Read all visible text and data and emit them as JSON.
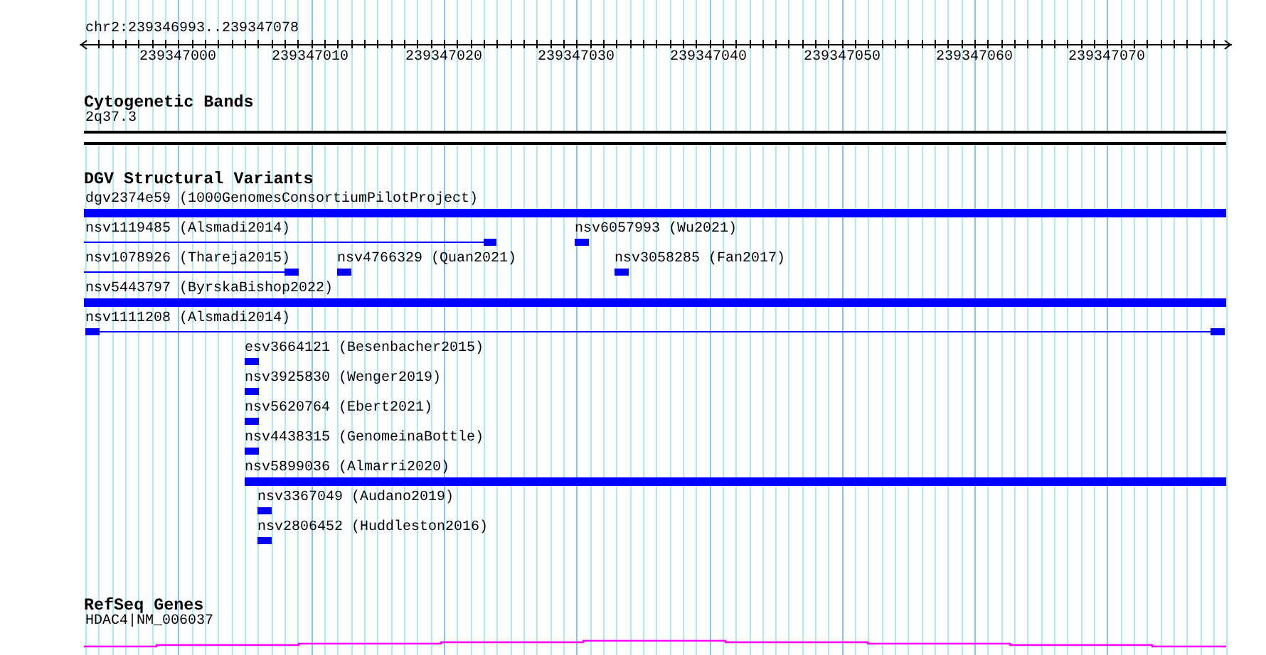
{
  "ruler": {
    "range": "chr2:239346993..239347078",
    "tick_labels": [
      "239347000",
      "239347010",
      "239347020",
      "239347030",
      "239347040",
      "239347050",
      "239347060",
      "239347070"
    ]
  },
  "cytogenetic_bands": {
    "title": "Cytogenetic Bands",
    "features": [
      {
        "kind": "band",
        "label": "2q37.3"
      }
    ]
  },
  "dgv_structural_variants": {
    "title": "DGV Structural Variants",
    "features": [
      {
        "kind": "bar",
        "label": "dgv2374e59 (1000GenomesConsortiumPilotProject)"
      },
      {
        "kind": "linked",
        "label": "nsv1119485 (Alsmadi2014)"
      },
      {
        "kind": "block",
        "label": "nsv6057993 (Wu2021)"
      },
      {
        "kind": "linked",
        "label": "nsv1078926 (Thareja2015)"
      },
      {
        "kind": "block",
        "label": "nsv4766329 (Quan2021)"
      },
      {
        "kind": "block",
        "label": "nsv3058285 (Fan2017)"
      },
      {
        "kind": "bar",
        "label": "nsv5443797 (ByrskaBishop2022)"
      },
      {
        "kind": "linked",
        "label": "nsv1111208 (Alsmadi2014)"
      },
      {
        "kind": "block",
        "label": "esv3664121 (Besenbacher2015)"
      },
      {
        "kind": "block",
        "label": "nsv3925830 (Wenger2019)"
      },
      {
        "kind": "block",
        "label": "nsv5620764 (Ebert2021)"
      },
      {
        "kind": "block",
        "label": "nsv4438315 (GenomeinaBottle)"
      },
      {
        "kind": "bar",
        "label": "nsv5899036 (Almarri2020)"
      },
      {
        "kind": "block",
        "label": "nsv3367049 (Audano2019)"
      },
      {
        "kind": "block",
        "label": "nsv2806452 (Huddleston2016)"
      }
    ]
  },
  "refseq_genes": {
    "title": "RefSeq Genes",
    "features": [
      {
        "kind": "gene",
        "label": "HDAC4|NM_006037"
      }
    ]
  }
}
